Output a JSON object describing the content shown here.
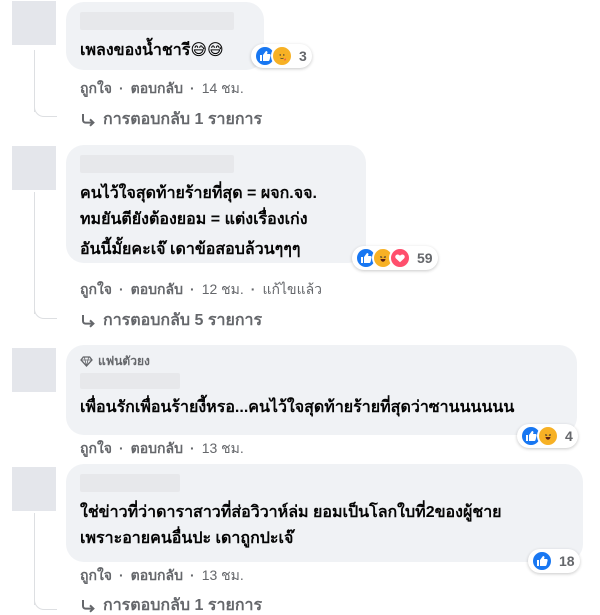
{
  "comments": [
    {
      "text_lines": [
        "เพลงของน้ำชารี😅😅"
      ],
      "reactions": {
        "icons": [
          "like-icon",
          "care-icon"
        ],
        "count": "3"
      },
      "actions": {
        "like": "ถูกใจ",
        "reply": "ตอบกลับ",
        "separator": "·",
        "time": "14 ชม."
      },
      "replies": {
        "label": "การตอบกลับ 1 รายการ"
      }
    },
    {
      "text_lines": [
        "คนไว้ใจสุดท้ายร้ายที่สุด = ผจก.จจ.",
        "ทมยันตียังต้องยอม = แต่งเรื่องเก่ง",
        "อันนี้มั้ยคะเจ๊ เดาข้อสอบล้วนๆๆๆ"
      ],
      "reactions": {
        "icons": [
          "like-icon",
          "haha-icon",
          "love-icon"
        ],
        "count": "59"
      },
      "actions": {
        "like": "ถูกใจ",
        "reply": "ตอบกลับ",
        "separator": "·",
        "time": "12 ชม.",
        "edited": "แก้ไขแล้ว"
      },
      "replies": {
        "label": "การตอบกลับ 5 รายการ"
      }
    },
    {
      "fan_badge": "แฟนตัวยง",
      "text_lines": [
        "เพื่อนรักเพื่อนร้ายงี้หรอ...คนไว้ใจสุดท้ายร้ายที่สุดว่าซานนนนนน"
      ],
      "reactions": {
        "icons": [
          "like-icon",
          "haha-icon"
        ],
        "count": "4"
      },
      "actions": {
        "like": "ถูกใจ",
        "reply": "ตอบกลับ",
        "separator": "·",
        "time": "13 ชม."
      }
    },
    {
      "text_lines": [
        "ใช่ข่าวที่ว่าดาราสาวที่ส่อวิวาห์ล่ม ยอมเป็นโลกใบที่2ของผู้ชาย",
        "เพราะอายคนอื่นปะ เดาถูกปะเจ๊"
      ],
      "reactions": {
        "icons": [
          "like-icon"
        ],
        "count": "18"
      },
      "actions": {
        "like": "ถูกใจ",
        "reply": "ตอบกลับ",
        "separator": "·",
        "time": "13 ชม."
      },
      "replies": {
        "label": "การตอบกลับ 1 รายการ"
      }
    }
  ],
  "colors": {
    "bubble": "#f0f2f5",
    "avatar": "#e4e6eb",
    "meta_text": "#65676b",
    "like_blue": "#1877f2",
    "haha_yellow": "#f7b125",
    "love_red": "#ff4f6d"
  }
}
